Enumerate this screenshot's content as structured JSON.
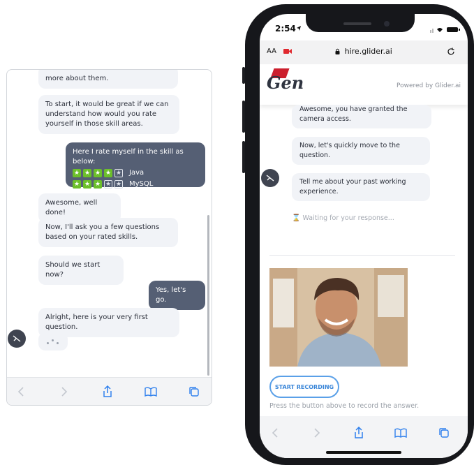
{
  "left_chat": {
    "messages": [
      {
        "text": "more about them."
      },
      {
        "text": "To start, it would be great if we can understand how would you rate yourself in those skill areas."
      },
      {
        "text": "Here I rate myself in the skill as below:"
      },
      {
        "text": "Awesome, well done!"
      },
      {
        "text": "Now, I'll ask you a few questions based on your rated skills."
      },
      {
        "text": "Should we start now?"
      },
      {
        "text": "Yes, let's go."
      },
      {
        "text": "Alright, here is your very first question."
      }
    ],
    "skills": [
      {
        "name": "Java",
        "rating": 4,
        "max": 5
      },
      {
        "name": "MySQL",
        "rating": 3,
        "max": 5
      }
    ],
    "toolbar_icons": [
      "back-icon",
      "forward-icon",
      "share-icon",
      "bookmarks-icon",
      "tabs-icon"
    ]
  },
  "phone": {
    "status_time": "2:54",
    "safari": {
      "text_size": "AA",
      "url": "hire.glider.ai"
    },
    "logo": "Gen",
    "powered_by": "Powered by Glider.ai",
    "messages": [
      {
        "text": "Awesome, you have granted the camera access."
      },
      {
        "text": "Now, let's quickly move to the question."
      },
      {
        "text": "Tell me about your past working experience."
      }
    ],
    "waiting": "Waiting for your response...",
    "record_button": "START RECORDING",
    "hint": "Press the button above to record the answer."
  },
  "colors": {
    "accent": "#3a86d8",
    "star": "#6cbf2a",
    "out_bubble": "#555f74"
  }
}
